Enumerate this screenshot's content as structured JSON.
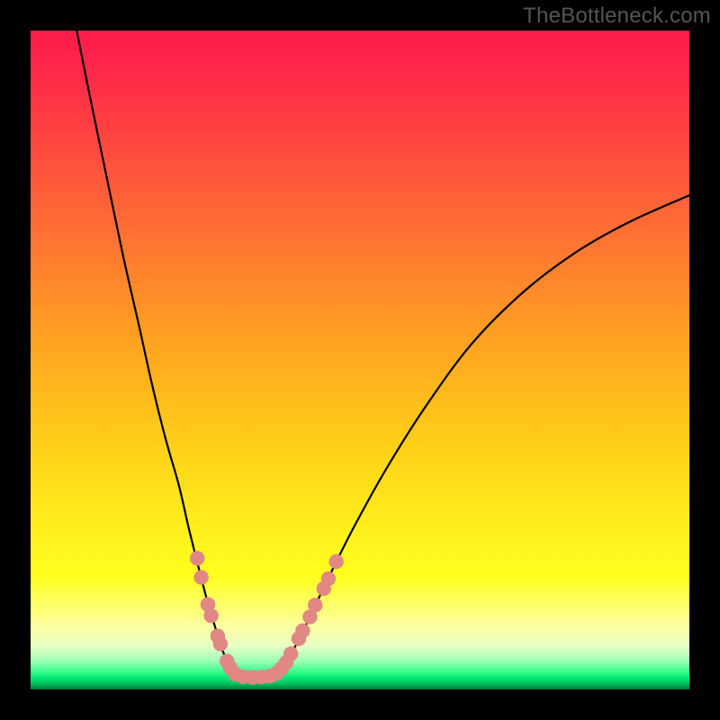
{
  "watermark": "TheBottleneck.com",
  "gradient_colors": {
    "top": "#ff1a4b",
    "mid_orange": "#ff9924",
    "yellow": "#ffff1f",
    "green_light": "#3fff8e",
    "green_dark": "#007a38"
  },
  "chart_data": {
    "type": "line",
    "title": "",
    "xlabel": "",
    "ylabel": "",
    "xlim": [
      0,
      100
    ],
    "ylim": [
      0,
      100
    ],
    "series": [
      {
        "name": "left-curve",
        "x": [
          7,
          9,
          11.5,
          14,
          16.5,
          18.5,
          20.5,
          22.5,
          24,
          25.5,
          26.8,
          28,
          29,
          29.8,
          30.4,
          30.8,
          31.2,
          31.6
        ],
        "y": [
          100,
          90,
          78,
          66,
          55,
          46,
          38,
          31,
          24.5,
          18.5,
          13.5,
          9.5,
          6.3,
          4.3,
          3.1,
          2.6,
          2.2,
          2.0
        ]
      },
      {
        "name": "valley-floor",
        "x": [
          31.6,
          32.5,
          33.5,
          34.6,
          35.6,
          36.6
        ],
        "y": [
          2.0,
          1.85,
          1.82,
          1.85,
          1.92,
          2.05
        ]
      },
      {
        "name": "right-curve",
        "x": [
          36.6,
          37.6,
          38.7,
          40.2,
          42.2,
          45,
          49,
          54,
          60,
          67,
          75,
          83,
          91,
          100
        ],
        "y": [
          2.05,
          2.6,
          3.9,
          6.6,
          10.6,
          16.5,
          24.5,
          33.5,
          43,
          52.5,
          60.5,
          66.5,
          71,
          75
        ]
      }
    ],
    "beads": {
      "color": "#e18784",
      "radius_px": 8.2,
      "points": [
        {
          "x": 25.3,
          "y": 19.9
        },
        {
          "x": 25.9,
          "y": 17.0
        },
        {
          "x": 26.9,
          "y": 12.9
        },
        {
          "x": 27.4,
          "y": 11.2
        },
        {
          "x": 28.4,
          "y": 8.1
        },
        {
          "x": 28.8,
          "y": 6.9
        },
        {
          "x": 29.8,
          "y": 4.3
        },
        {
          "x": 30.3,
          "y": 3.3
        },
        {
          "x": 31.1,
          "y": 2.3
        },
        {
          "x": 32.3,
          "y": 1.9
        },
        {
          "x": 33.7,
          "y": 1.83
        },
        {
          "x": 35.0,
          "y": 1.88
        },
        {
          "x": 36.3,
          "y": 2.0
        },
        {
          "x": 37.3,
          "y": 2.4
        },
        {
          "x": 38.1,
          "y": 3.2
        },
        {
          "x": 38.8,
          "y": 4.1
        },
        {
          "x": 39.5,
          "y": 5.4
        },
        {
          "x": 40.7,
          "y": 7.7
        },
        {
          "x": 41.3,
          "y": 8.9
        },
        {
          "x": 42.4,
          "y": 11.0
        },
        {
          "x": 43.2,
          "y": 12.8
        },
        {
          "x": 44.5,
          "y": 15.3
        },
        {
          "x": 45.2,
          "y": 16.8
        },
        {
          "x": 46.4,
          "y": 19.4
        }
      ]
    }
  }
}
